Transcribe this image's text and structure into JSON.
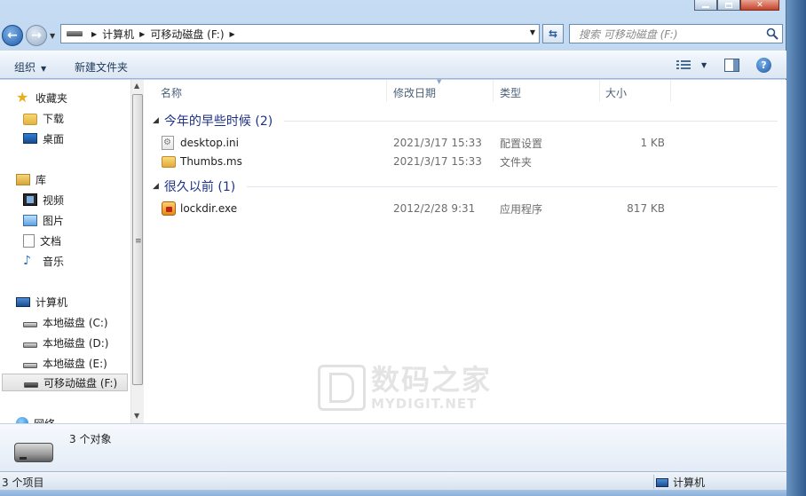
{
  "window": {
    "caption_buttons": [
      "minimize",
      "maximize",
      "close"
    ]
  },
  "address": {
    "crumbs": [
      "计算机",
      "可移动磁盘 (F:)"
    ],
    "search_placeholder": "搜索 可移动磁盘 (F:)"
  },
  "toolbar": {
    "organize": "组织",
    "new_folder": "新建文件夹"
  },
  "nav": {
    "favorites": "收藏夹",
    "downloads": "下载",
    "desktop": "桌面",
    "libraries": "库",
    "videos": "视频",
    "pictures": "图片",
    "documents": "文档",
    "music": "音乐",
    "computer": "计算机",
    "drive_c": "本地磁盘 (C:)",
    "drive_d": "本地磁盘 (D:)",
    "drive_e": "本地磁盘 (E:)",
    "drive_f": "可移动磁盘 (F:)",
    "network": "网络"
  },
  "columns": {
    "name": "名称",
    "date": "修改日期",
    "type": "类型",
    "size": "大小"
  },
  "groups": [
    {
      "title": "今年的早些时候 (2)",
      "files": [
        {
          "name": "desktop.ini",
          "date": "2021/3/17 15:33",
          "type": "配置设置",
          "size": "1 KB",
          "icon": "settings-file-icon"
        },
        {
          "name": "Thumbs.ms",
          "date": "2021/3/17 15:33",
          "type": "文件夹",
          "size": "",
          "icon": "folder-icon"
        }
      ]
    },
    {
      "title": "很久以前 (1)",
      "files": [
        {
          "name": "lockdir.exe",
          "date": "2012/2/28 9:31",
          "type": "应用程序",
          "size": "817 KB",
          "icon": "application-icon"
        }
      ]
    }
  ],
  "watermark": {
    "cn": "数码之家",
    "en": "MYDIGIT.NET"
  },
  "details": {
    "count": "3 个对象"
  },
  "status": {
    "items": "3 个项目",
    "location": "计算机"
  }
}
